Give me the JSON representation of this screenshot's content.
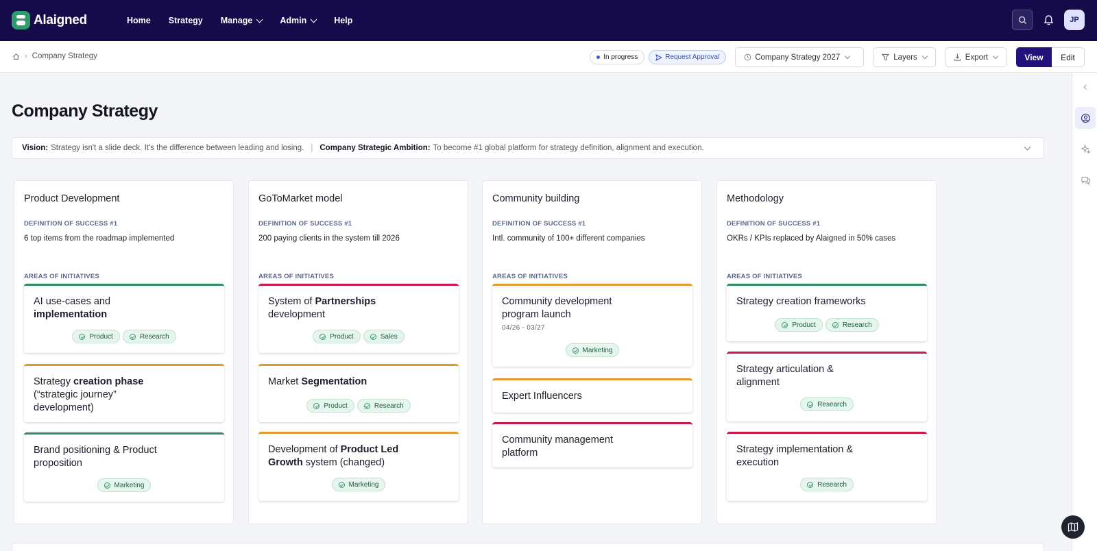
{
  "app": {
    "name": "Alaigned"
  },
  "nav": {
    "home": "Home",
    "strategy": "Strategy",
    "manage": "Manage",
    "admin": "Admin",
    "help": "Help"
  },
  "user": {
    "initials": "JP"
  },
  "breadcrumb": {
    "current": "Company Strategy"
  },
  "toolbar": {
    "status": "In progress",
    "request_approval": "Request Approval",
    "strategy_select": "Company Strategy 2027",
    "layers": "Layers",
    "export": "Export",
    "view": "View",
    "edit": "Edit"
  },
  "page": {
    "title": "Company Strategy",
    "vision_label": "Vision:",
    "vision_text": "Strategy isn't a slide deck. It's the difference between leading and losing.",
    "ambition_label": "Company Strategic Ambition:",
    "ambition_text": "To become #1 global platform for strategy definition, alignment and execution."
  },
  "labels": {
    "dos": "DEFINITION OF SUCCESS #1",
    "aoi": "AREAS OF INITIATIVES"
  },
  "columns": [
    {
      "title": "Product Development",
      "dos": "6 top items from the roadmap implemented",
      "cards": [
        {
          "pre": "AI use-cases and",
          "bold": "implementation",
          "post": "",
          "tags": [
            "Product",
            "Research"
          ]
        },
        {
          "pre": "Strategy",
          "bold": "creation phase",
          "post": "(“strategic journey” development)",
          "tags": []
        },
        {
          "pre": "Brand positioning & Product proposition",
          "bold": "",
          "post": "",
          "tags": [
            "Marketing"
          ]
        }
      ]
    },
    {
      "title": "GoToMarket model",
      "dos": "200 paying clients in the system till 2026",
      "cards": [
        {
          "pre": "System of",
          "bold": "Partnerships",
          "post": "development",
          "tags": [
            "Product",
            "Sales"
          ]
        },
        {
          "pre": "Market",
          "bold": "Segmentation",
          "post": "",
          "tags": [
            "Product",
            "Research"
          ]
        },
        {
          "pre": "Development of",
          "bold": "Product Led Growth",
          "post": "system (changed)",
          "tags": [
            "Marketing"
          ]
        }
      ]
    },
    {
      "title": "Community building",
      "dos": "Intl. community of 100+ different companies",
      "cards": [
        {
          "pre": "Community development program launch",
          "bold": "",
          "post": "",
          "date": "04/26 - 03/27",
          "tags": [
            "Marketing"
          ]
        },
        {
          "pre": "Expert Influencers",
          "bold": "",
          "post": "",
          "tags": []
        },
        {
          "pre": "Community management platform",
          "bold": "",
          "post": "",
          "tags": []
        }
      ]
    },
    {
      "title": "Methodology",
      "dos": "OKRs / KPIs replaced by Alaigned in 50% cases",
      "cards": [
        {
          "pre": "Strategy creation frameworks",
          "bold": "",
          "post": "",
          "tags": [
            "Product",
            "Research"
          ]
        },
        {
          "pre": "Strategy articulation & alignment",
          "bold": "",
          "post": "",
          "tags": [
            "Research"
          ]
        },
        {
          "pre": "Strategy implementation & execution",
          "bold": "",
          "post": "",
          "tags": [
            "Research"
          ]
        }
      ]
    }
  ],
  "colors": {
    "nav_bg": "#150a4a",
    "primary": "#23127a",
    "green": "#2e8b5e",
    "orange": "#e29a2d",
    "red": "#c8194a"
  }
}
